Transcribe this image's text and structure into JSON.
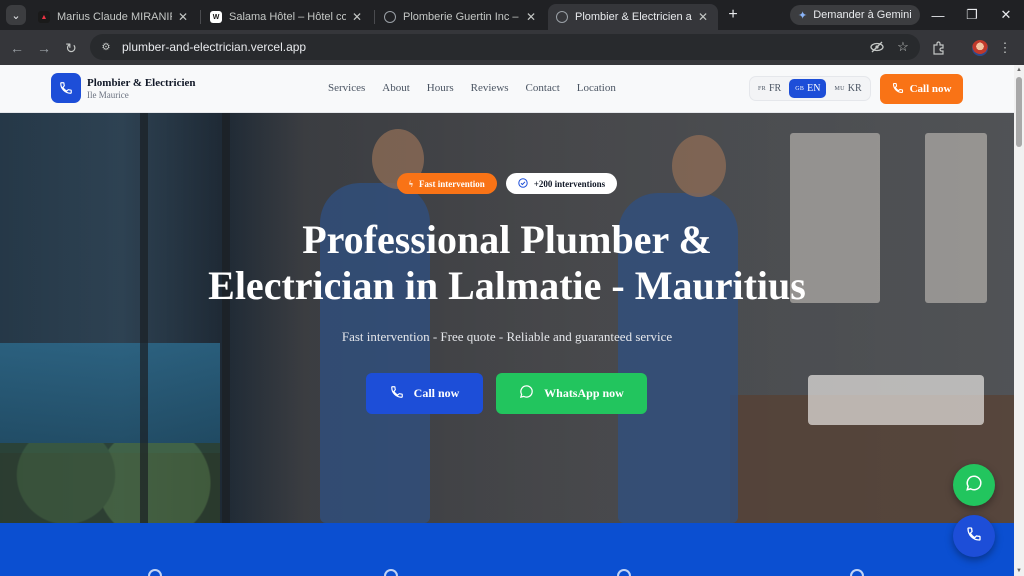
{
  "browser": {
    "tabs": [
      {
        "title": "Marius Claude MIRANIRINA | ",
        "active": false
      },
      {
        "title": "Salama Hôtel – Hôtel confortab",
        "active": false
      },
      {
        "title": "Plomberie Guertin Inc – Plomb",
        "active": false
      },
      {
        "title": "Plombier & Electricien a Lalma",
        "active": true
      }
    ],
    "new_tab_glyph": "+",
    "gemini_label": "Demander à Gemini",
    "url": "plumber-and-electrician.vercel.app"
  },
  "site": {
    "brand": {
      "name": "Plombier & Electricien",
      "subtitle": "Ile Maurice"
    },
    "nav": [
      "Services",
      "About",
      "Hours",
      "Reviews",
      "Contact",
      "Location"
    ],
    "languages": [
      {
        "code": "FR",
        "label": "FR",
        "active": false
      },
      {
        "code": "GB",
        "label": "EN",
        "active": true
      },
      {
        "code": "MU",
        "label": "KR",
        "active": false
      }
    ],
    "header_cta": "Call now",
    "hero": {
      "badge_fast": "Fast intervention",
      "badge_count": "+200 interventions",
      "title_line1": "Professional Plumber &",
      "title_line2": "Electrician in Lalmatie - Mauritius",
      "subtitle": "Fast intervention - Free quote - Reliable and guaranteed service",
      "cta_call": "Call now",
      "cta_whatsapp": "WhatsApp now"
    },
    "colors": {
      "primary": "#1d4ed8",
      "accent": "#f97316",
      "whatsapp": "#22c55e"
    }
  }
}
